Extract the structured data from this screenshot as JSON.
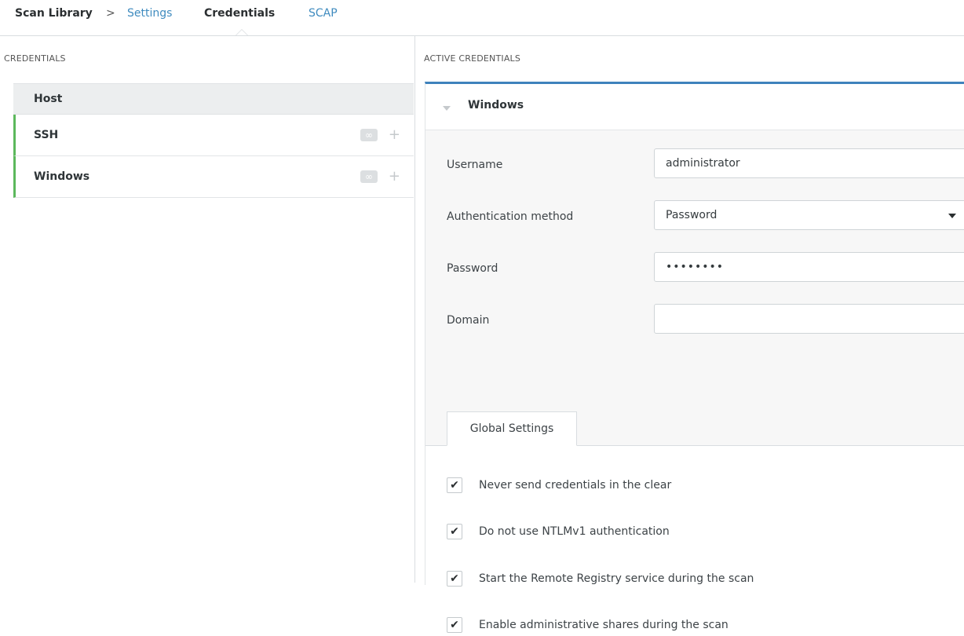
{
  "breadcrumb": {
    "root": "Scan Library",
    "separator": ">",
    "tabs": [
      {
        "label": "Settings",
        "state": "link"
      },
      {
        "label": "Credentials",
        "state": "active"
      },
      {
        "label": "SCAP",
        "state": "link"
      }
    ]
  },
  "left_panel": {
    "section_title": "CREDENTIALS",
    "host_label": "Host",
    "items": [
      {
        "label": "SSH",
        "badge_icon": "infinity-icon",
        "add_icon": "plus-icon"
      },
      {
        "label": "Windows",
        "badge_icon": "infinity-icon",
        "add_icon": "plus-icon"
      }
    ]
  },
  "right_panel": {
    "section_title": "ACTIVE CREDENTIALS",
    "panel_title": "Windows",
    "fields": {
      "username": {
        "label": "Username",
        "value": "administrator"
      },
      "auth_method": {
        "label": "Authentication method",
        "value": "Password"
      },
      "password": {
        "label": "Password",
        "value": "••••••••"
      },
      "domain": {
        "label": "Domain",
        "value": ""
      }
    },
    "tab_label": "Global Settings",
    "checkboxes": [
      {
        "label": "Never send credentials in the clear",
        "checked": true
      },
      {
        "label": "Do not use NTLMv1 authentication",
        "checked": true
      },
      {
        "label": "Start the Remote Registry service during the scan",
        "checked": true
      },
      {
        "label": "Enable administrative shares during the scan",
        "checked": true
      }
    ]
  },
  "colors": {
    "accent_blue": "#3f82bc",
    "link_blue": "#3f8bbf",
    "active_green": "#5cb85c"
  }
}
